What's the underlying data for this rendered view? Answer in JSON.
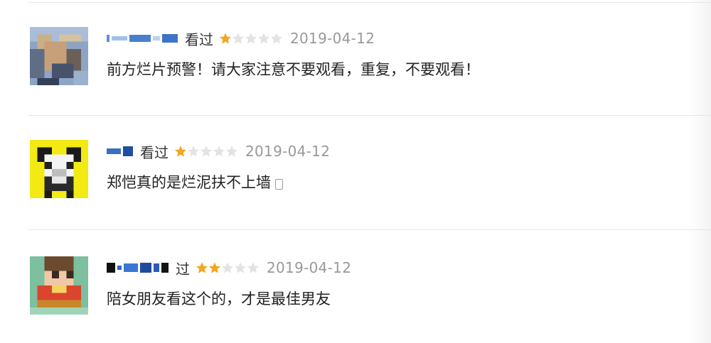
{
  "comments": [
    {
      "status": "看过",
      "rating": 1,
      "max_rating": 5,
      "date": "2019-04-12",
      "text": "前方烂片预警！请大家注意不要观看，重复，不要观看！",
      "trailing_icon": ""
    },
    {
      "status": "看过",
      "rating": 1,
      "max_rating": 5,
      "date": "2019-04-12",
      "text": "郑恺真的是烂泥扶不上墙",
      "trailing_icon": "phone-icon"
    },
    {
      "status": "过",
      "rating": 2,
      "max_rating": 5,
      "date": "2019-04-12",
      "text": "陪女朋友看这个的，才是最佳男友",
      "trailing_icon": ""
    }
  ],
  "colors": {
    "star_filled": "#f4a620",
    "star_empty": "#e3e3e3",
    "date": "#999999",
    "divider": "#e6e6e6",
    "text": "#222222"
  }
}
